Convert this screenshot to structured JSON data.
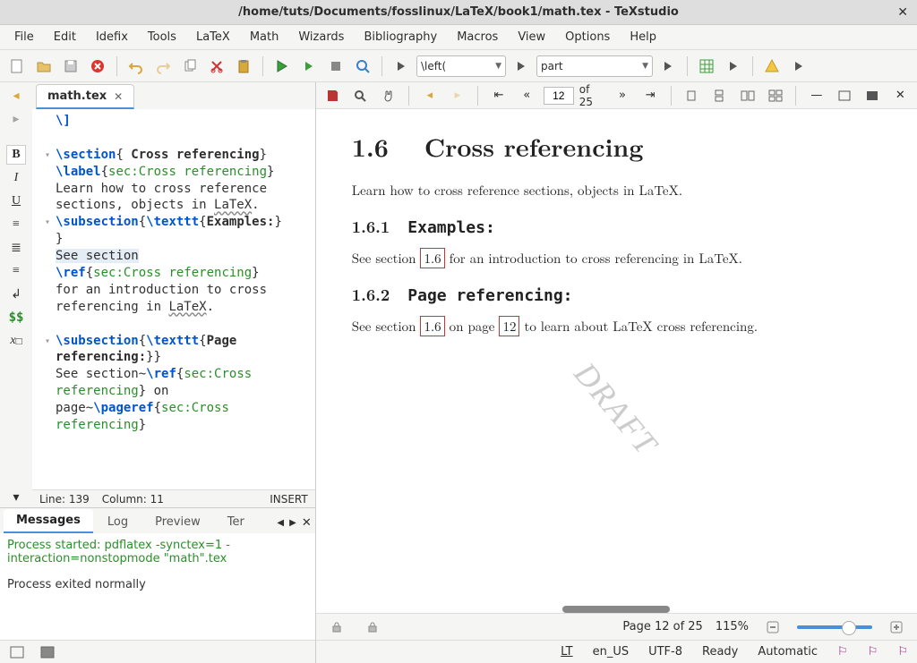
{
  "window": {
    "title": "/home/tuts/Documents/fosslinux/LaTeX/book1/math.tex - TeXstudio"
  },
  "menu": {
    "items": [
      "File",
      "Edit",
      "Idefix",
      "Tools",
      "LaTeX",
      "Math",
      "Wizards",
      "Bibliography",
      "Macros",
      "View",
      "Options",
      "Help"
    ]
  },
  "toolbar": {
    "combo1": "\\left(",
    "combo2": "part"
  },
  "tabs": {
    "active": "math.tex"
  },
  "editor": {
    "lines": [
      {
        "fold": "",
        "raw": "<span class='cmd'>\\]</span>"
      },
      {
        "fold": "",
        "raw": ""
      },
      {
        "fold": "▾",
        "raw": "<span class='cmd'>\\section</span>{<span class='kw'> Cross referencing</span>}"
      },
      {
        "fold": "",
        "raw": "<span class='cmd'>\\label</span>{<span class='grp'>sec:Cross referencing</span>}"
      },
      {
        "fold": "",
        "raw": "<span class='txt'>Learn how to cross reference</span>"
      },
      {
        "fold": "",
        "raw": "<span class='txt'>sections, objects in <span class='wavyu'>LaTeX</span>.</span>"
      },
      {
        "fold": "▾",
        "raw": "<span class='cmd'>\\subsection</span>{<span class='cmd'>\\texttt</span>{<span class='kw'>Examples:</span>}"
      },
      {
        "fold": "",
        "raw": "}"
      },
      {
        "fold": "",
        "raw": "<span class='hl'>See section</span>"
      },
      {
        "fold": "",
        "raw": "<span class='cmd'>\\ref</span>{<span class='grp'>sec:Cross referencing</span>}"
      },
      {
        "fold": "",
        "raw": "<span class='txt'>for an introduction to cross</span>"
      },
      {
        "fold": "",
        "raw": "<span class='txt'>referencing in <span class='wavyu'>LaTeX</span>.</span>"
      },
      {
        "fold": "",
        "raw": ""
      },
      {
        "fold": "▾",
        "raw": "<span class='cmd'>\\subsection</span>{<span class='cmd'>\\texttt</span>{<span class='kw'>Page</span>"
      },
      {
        "fold": "",
        "raw": "<span class='kw'>referencing:</span>}}"
      },
      {
        "fold": "",
        "raw": "<span class='txt'>See section~</span><span class='cmd'>\\ref</span>{<span class='grp'>sec:Cross</span>"
      },
      {
        "fold": "",
        "raw": "<span class='grp'>referencing</span>} on"
      },
      {
        "fold": "",
        "raw": "<span class='txt'>page~</span><span class='cmd'>\\pageref</span>{<span class='grp'>sec:Cross</span>"
      },
      {
        "fold": "",
        "raw": "<span class='grp'>referencing</span>}"
      }
    ],
    "status": {
      "line": "Line: 139",
      "col": "Column: 11",
      "mode": "INSERT"
    }
  },
  "messages": {
    "tabs": [
      "Messages",
      "Log",
      "Preview",
      "Terminal"
    ],
    "active": 0,
    "line1": "Process started: pdflatex -synctex=1 -interaction=nonstopmode \"math\".tex",
    "line2": "Process exited normally"
  },
  "pdf": {
    "toolbar": {
      "page_current": "12",
      "page_of": "of 25"
    },
    "content": {
      "h1_num": "1.6",
      "h1": "Cross referencing",
      "p1": "Learn how to cross reference sections, objects in LaTeX.",
      "h2a_num": "1.6.1",
      "h2a": "Examples:",
      "p2a_pre": "See section ",
      "p2a_link": "1.6",
      "p2a_post": " for an introduction to cross referencing in LaTeX.",
      "h2b_num": "1.6.2",
      "h2b": "Page referencing:",
      "p3_pre": "See section ",
      "p3_l1": "1.6",
      "p3_mid": " on page ",
      "p3_l2": "12",
      "p3_post": " to learn about LaTeX cross referencing.",
      "draft": "DRAFT"
    },
    "status": {
      "page": "Page 12 of 25",
      "zoom": "115%"
    }
  },
  "appstatus": {
    "lt": "LT",
    "lang": "en_US",
    "enc": "UTF-8",
    "state": "Ready",
    "mode": "Automatic"
  },
  "gutter": {
    "labels": [
      "B",
      "I",
      "U",
      "≡",
      "≣",
      "≡",
      "↲",
      "$$",
      "x□"
    ]
  }
}
